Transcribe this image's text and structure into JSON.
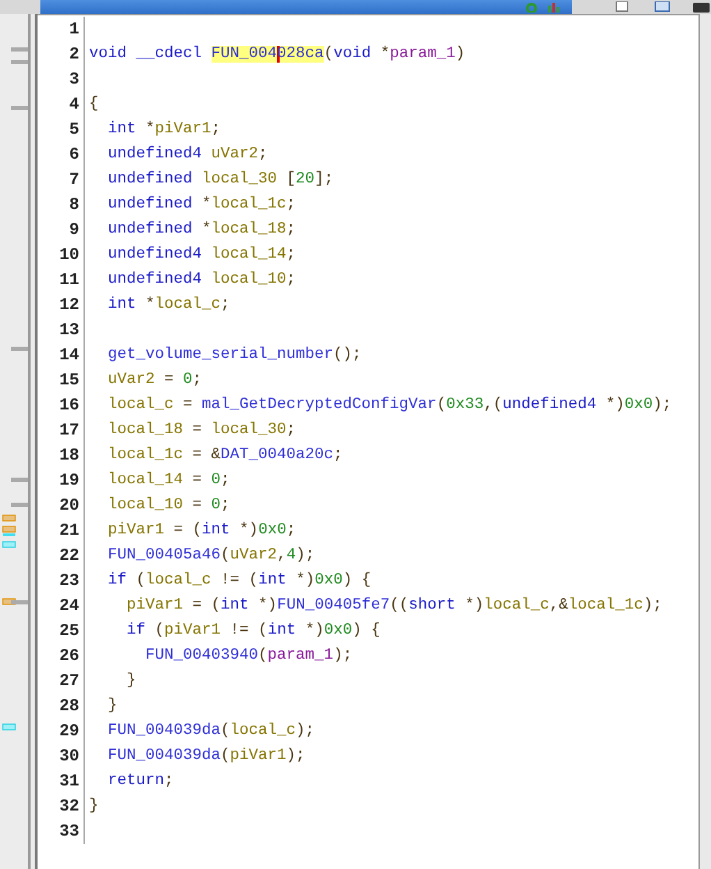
{
  "editor": {
    "lines": [
      {
        "number": "1"
      },
      {
        "number": "2",
        "tokens": [
          {
            "text": "void __cdecl ",
            "kind": "keyword"
          },
          {
            "text": "FUN_004",
            "kind": "function",
            "highlighted": true
          },
          {
            "text": "028ca",
            "kind": "function",
            "highlighted": true,
            "cursor": true
          },
          {
            "text": "(",
            "kind": "punct"
          },
          {
            "text": "void ",
            "kind": "keyword"
          },
          {
            "text": "*",
            "kind": "punct"
          },
          {
            "text": "param_1",
            "kind": "param"
          },
          {
            "text": ")",
            "kind": "punct"
          }
        ]
      },
      {
        "number": "3"
      },
      {
        "number": "4",
        "tokens": [
          {
            "text": "{",
            "kind": "punct"
          }
        ]
      },
      {
        "number": "5",
        "tokens": [
          {
            "text": "  int ",
            "kind": "keyword"
          },
          {
            "text": "*",
            "kind": "punct"
          },
          {
            "text": "piVar1",
            "kind": "variable"
          },
          {
            "text": ";",
            "kind": "punct"
          }
        ]
      },
      {
        "number": "6",
        "tokens": [
          {
            "text": "  undefined4 ",
            "kind": "keyword"
          },
          {
            "text": "uVar2",
            "kind": "variable"
          },
          {
            "text": ";",
            "kind": "punct"
          }
        ]
      },
      {
        "number": "7",
        "tokens": [
          {
            "text": "  undefined ",
            "kind": "keyword"
          },
          {
            "text": "local_30 ",
            "kind": "variable"
          },
          {
            "text": "[",
            "kind": "punct"
          },
          {
            "text": "20",
            "kind": "number"
          },
          {
            "text": "];",
            "kind": "punct"
          }
        ]
      },
      {
        "number": "8",
        "tokens": [
          {
            "text": "  undefined ",
            "kind": "keyword"
          },
          {
            "text": "*",
            "kind": "punct"
          },
          {
            "text": "local_1c",
            "kind": "variable"
          },
          {
            "text": ";",
            "kind": "punct"
          }
        ]
      },
      {
        "number": "9",
        "tokens": [
          {
            "text": "  undefined ",
            "kind": "keyword"
          },
          {
            "text": "*",
            "kind": "punct"
          },
          {
            "text": "local_18",
            "kind": "variable"
          },
          {
            "text": ";",
            "kind": "punct"
          }
        ]
      },
      {
        "number": "10",
        "tokens": [
          {
            "text": "  undefined4 ",
            "kind": "keyword"
          },
          {
            "text": "local_14",
            "kind": "variable"
          },
          {
            "text": ";",
            "kind": "punct"
          }
        ]
      },
      {
        "number": "11",
        "tokens": [
          {
            "text": "  undefined4 ",
            "kind": "keyword"
          },
          {
            "text": "local_10",
            "kind": "variable"
          },
          {
            "text": ";",
            "kind": "punct"
          }
        ]
      },
      {
        "number": "12",
        "tokens": [
          {
            "text": "  int ",
            "kind": "keyword"
          },
          {
            "text": "*",
            "kind": "punct"
          },
          {
            "text": "local_c",
            "kind": "variable"
          },
          {
            "text": ";",
            "kind": "punct"
          }
        ]
      },
      {
        "number": "13"
      },
      {
        "number": "14",
        "tokens": [
          {
            "text": "  get_volume_serial_number",
            "kind": "function"
          },
          {
            "text": "();",
            "kind": "punct"
          }
        ]
      },
      {
        "number": "15",
        "tokens": [
          {
            "text": "  uVar2",
            "kind": "variable"
          },
          {
            "text": " = ",
            "kind": "punct"
          },
          {
            "text": "0",
            "kind": "number"
          },
          {
            "text": ";",
            "kind": "punct"
          }
        ]
      },
      {
        "number": "16",
        "tokens": [
          {
            "text": "  local_c",
            "kind": "variable"
          },
          {
            "text": " = ",
            "kind": "punct"
          },
          {
            "text": "mal_GetDecryptedConfigVar",
            "kind": "function"
          },
          {
            "text": "(",
            "kind": "punct"
          },
          {
            "text": "0x33",
            "kind": "number"
          },
          {
            "text": ",(",
            "kind": "punct"
          },
          {
            "text": "undefined4 ",
            "kind": "keyword"
          },
          {
            "text": "*)",
            "kind": "punct"
          },
          {
            "text": "0x0",
            "kind": "number"
          },
          {
            "text": ");",
            "kind": "punct"
          }
        ]
      },
      {
        "number": "17",
        "tokens": [
          {
            "text": "  local_18",
            "kind": "variable"
          },
          {
            "text": " = ",
            "kind": "punct"
          },
          {
            "text": "local_30",
            "kind": "variable"
          },
          {
            "text": ";",
            "kind": "punct"
          }
        ]
      },
      {
        "number": "18",
        "tokens": [
          {
            "text": "  local_1c",
            "kind": "variable"
          },
          {
            "text": " = &",
            "kind": "punct"
          },
          {
            "text": "DAT_0040a20c",
            "kind": "function"
          },
          {
            "text": ";",
            "kind": "punct"
          }
        ]
      },
      {
        "number": "19",
        "tokens": [
          {
            "text": "  local_14",
            "kind": "variable"
          },
          {
            "text": " = ",
            "kind": "punct"
          },
          {
            "text": "0",
            "kind": "number"
          },
          {
            "text": ";",
            "kind": "punct"
          }
        ]
      },
      {
        "number": "20",
        "tokens": [
          {
            "text": "  local_10",
            "kind": "variable"
          },
          {
            "text": " = ",
            "kind": "punct"
          },
          {
            "text": "0",
            "kind": "number"
          },
          {
            "text": ";",
            "kind": "punct"
          }
        ]
      },
      {
        "number": "21",
        "tokens": [
          {
            "text": "  piVar1",
            "kind": "variable"
          },
          {
            "text": " = (",
            "kind": "punct"
          },
          {
            "text": "int ",
            "kind": "keyword"
          },
          {
            "text": "*)",
            "kind": "punct"
          },
          {
            "text": "0x0",
            "kind": "number"
          },
          {
            "text": ";",
            "kind": "punct"
          }
        ]
      },
      {
        "number": "22",
        "tokens": [
          {
            "text": "  FUN_00405a46",
            "kind": "function"
          },
          {
            "text": "(",
            "kind": "punct"
          },
          {
            "text": "uVar2",
            "kind": "variable"
          },
          {
            "text": ",",
            "kind": "punct"
          },
          {
            "text": "4",
            "kind": "number"
          },
          {
            "text": ");",
            "kind": "punct"
          }
        ]
      },
      {
        "number": "23",
        "tokens": [
          {
            "text": "  if ",
            "kind": "keyword"
          },
          {
            "text": "(",
            "kind": "punct"
          },
          {
            "text": "local_c",
            "kind": "variable"
          },
          {
            "text": " != (",
            "kind": "punct"
          },
          {
            "text": "int ",
            "kind": "keyword"
          },
          {
            "text": "*)",
            "kind": "punct"
          },
          {
            "text": "0x0",
            "kind": "number"
          },
          {
            "text": ") {",
            "kind": "punct"
          }
        ]
      },
      {
        "number": "24",
        "tokens": [
          {
            "text": "    piVar1",
            "kind": "variable"
          },
          {
            "text": " = (",
            "kind": "punct"
          },
          {
            "text": "int ",
            "kind": "keyword"
          },
          {
            "text": "*)",
            "kind": "punct"
          },
          {
            "text": "FUN_00405fe7",
            "kind": "function"
          },
          {
            "text": "((",
            "kind": "punct"
          },
          {
            "text": "short ",
            "kind": "keyword"
          },
          {
            "text": "*)",
            "kind": "punct"
          },
          {
            "text": "local_c",
            "kind": "variable"
          },
          {
            "text": ",&",
            "kind": "punct"
          },
          {
            "text": "local_1c",
            "kind": "variable"
          },
          {
            "text": ");",
            "kind": "punct"
          }
        ]
      },
      {
        "number": "25",
        "tokens": [
          {
            "text": "    if ",
            "kind": "keyword"
          },
          {
            "text": "(",
            "kind": "punct"
          },
          {
            "text": "piVar1",
            "kind": "variable"
          },
          {
            "text": " != (",
            "kind": "punct"
          },
          {
            "text": "int ",
            "kind": "keyword"
          },
          {
            "text": "*)",
            "kind": "punct"
          },
          {
            "text": "0x0",
            "kind": "number"
          },
          {
            "text": ") {",
            "kind": "punct"
          }
        ]
      },
      {
        "number": "26",
        "tokens": [
          {
            "text": "      FUN_00403940",
            "kind": "function"
          },
          {
            "text": "(",
            "kind": "punct"
          },
          {
            "text": "param_1",
            "kind": "param"
          },
          {
            "text": ");",
            "kind": "punct"
          }
        ]
      },
      {
        "number": "27",
        "tokens": [
          {
            "text": "    }",
            "kind": "punct"
          }
        ]
      },
      {
        "number": "28",
        "tokens": [
          {
            "text": "  }",
            "kind": "punct"
          }
        ]
      },
      {
        "number": "29",
        "tokens": [
          {
            "text": "  FUN_004039da",
            "kind": "function"
          },
          {
            "text": "(",
            "kind": "punct"
          },
          {
            "text": "local_c",
            "kind": "variable"
          },
          {
            "text": ");",
            "kind": "punct"
          }
        ]
      },
      {
        "number": "30",
        "tokens": [
          {
            "text": "  FUN_004039da",
            "kind": "function"
          },
          {
            "text": "(",
            "kind": "punct"
          },
          {
            "text": "piVar1",
            "kind": "variable"
          },
          {
            "text": ");",
            "kind": "punct"
          }
        ]
      },
      {
        "number": "31",
        "tokens": [
          {
            "text": "  return",
            "kind": "keyword"
          },
          {
            "text": ";",
            "kind": "punct"
          }
        ]
      },
      {
        "number": "32",
        "tokens": [
          {
            "text": "}",
            "kind": "punct"
          }
        ]
      },
      {
        "number": "33"
      }
    ]
  }
}
